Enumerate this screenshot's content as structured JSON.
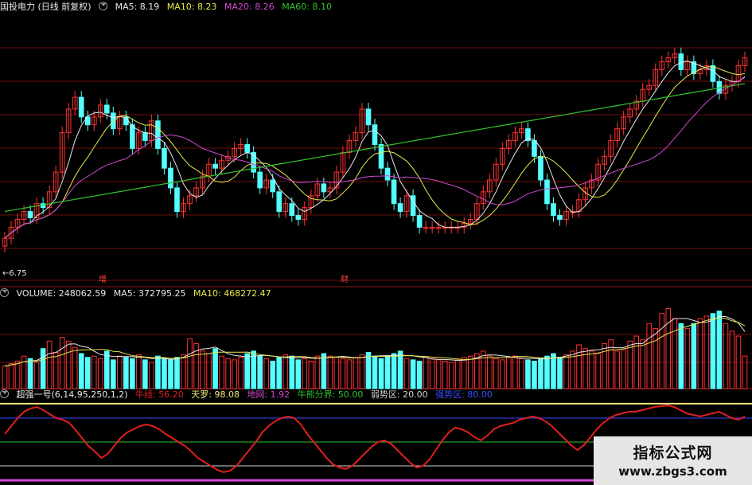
{
  "main_header": {
    "title": "国投电力 (日线 前复权)",
    "ma5": "MA5: 8.19",
    "ma10": "MA10: 8.23",
    "ma20": "MA20: 8.26",
    "ma60": "MA60: 8.10"
  },
  "price_low_label": "←6.75",
  "event_tags": [
    "增",
    "财"
  ],
  "volume_header": {
    "volume": "VOLUME: 248062.59",
    "ma5": "MA5: 372795.25",
    "ma10": "MA10: 468272.47"
  },
  "indicator_header": {
    "name": "超强一号(6,14,95,250,1,2)",
    "c1": "牛线: 56.20",
    "c2": "天罗: 98.08",
    "c3": "地网: 1.92",
    "c4": "牛熊分界: 50.00",
    "c5": "弱势区: 20.00",
    "c6": "强势区: 80.00"
  },
  "watermark": {
    "line1": "指标公式网",
    "line2": "www.zbgs3.com"
  },
  "colors": {
    "up": "#ff3232",
    "down": "#54ffff",
    "ma5": "#e8e8e8",
    "ma10": "#e8e84a",
    "ma20": "#d24ad2",
    "ma60": "#2ec42e",
    "grid": "#6e0e0e",
    "osc": "#e02020",
    "band": "#f2e87a"
  },
  "chart_data": {
    "type": "candlestick",
    "price_range": [
      6.75,
      9.6
    ],
    "close": [
      6.96,
      7.1,
      7.2,
      7.3,
      7.22,
      7.4,
      7.35,
      7.55,
      7.8,
      8.3,
      8.6,
      8.75,
      8.5,
      8.4,
      8.5,
      8.65,
      8.55,
      8.35,
      8.5,
      8.4,
      8.1,
      8.3,
      8.2,
      8.45,
      8.1,
      7.85,
      7.6,
      7.3,
      7.4,
      7.5,
      7.6,
      7.75,
      7.9,
      7.85,
      7.95,
      8.0,
      8.1,
      8.15,
      8.05,
      7.8,
      7.6,
      7.7,
      7.55,
      7.3,
      7.4,
      7.25,
      7.2,
      7.35,
      7.5,
      7.65,
      7.55,
      7.6,
      7.8,
      8.05,
      8.2,
      8.3,
      8.6,
      8.4,
      8.15,
      7.85,
      7.7,
      7.4,
      7.3,
      7.5,
      7.25,
      7.1,
      7.1,
      7.1,
      7.1,
      7.1,
      7.1,
      7.1,
      7.15,
      7.2,
      7.4,
      7.55,
      7.7,
      7.9,
      8.1,
      8.2,
      8.3,
      8.35,
      8.2,
      8.0,
      7.7,
      7.4,
      7.25,
      7.2,
      7.3,
      7.3,
      7.45,
      7.6,
      7.7,
      7.9,
      8.0,
      8.2,
      8.35,
      8.5,
      8.6,
      8.7,
      8.85,
      8.9,
      9.1,
      9.2,
      9.25,
      9.3,
      9.1,
      9.2,
      9.05,
      9.1,
      9.15,
      8.95,
      8.8,
      8.9,
      8.95,
      9.15,
      9.25
    ],
    "volume_range": [
      0,
      700000
    ],
    "volume": [
      180000,
      200000,
      220000,
      260000,
      240000,
      210000,
      320000,
      380000,
      290000,
      410000,
      380000,
      330000,
      280000,
      250000,
      260000,
      240000,
      300000,
      230000,
      260000,
      250000,
      240000,
      270000,
      230000,
      210000,
      260000,
      240000,
      230000,
      250000,
      270000,
      400000,
      360000,
      300000,
      280000,
      320000,
      260000,
      240000,
      230000,
      250000,
      280000,
      300000,
      260000,
      240000,
      220000,
      250000,
      270000,
      260000,
      230000,
      240000,
      220000,
      260000,
      280000,
      260000,
      250000,
      240000,
      230000,
      250000,
      270000,
      290000,
      260000,
      240000,
      260000,
      280000,
      300000,
      240000,
      230000,
      220000,
      250000,
      240000,
      230000,
      220000,
      210000,
      230000,
      250000,
      260000,
      280000,
      300000,
      260000,
      240000,
      230000,
      250000,
      260000,
      240000,
      230000,
      220000,
      240000,
      260000,
      280000,
      250000,
      270000,
      300000,
      350000,
      320000,
      300000,
      280000,
      360000,
      390000,
      300000,
      310000,
      380000,
      420000,
      390000,
      520000,
      480000,
      600000,
      640000,
      560000,
      520000,
      480000,
      520000,
      560000,
      580000,
      600000,
      620000,
      520000,
      460000,
      420000,
      260000
    ],
    "oscillator_range": [
      0,
      100
    ],
    "oscillator": [
      60,
      70,
      80,
      88,
      92,
      94,
      90,
      85,
      80,
      78,
      74,
      65,
      55,
      45,
      38,
      30,
      35,
      45,
      55,
      62,
      66,
      70,
      72,
      70,
      66,
      60,
      55,
      50,
      45,
      38,
      30,
      25,
      20,
      15,
      12,
      14,
      20,
      30,
      40,
      50,
      62,
      70,
      76,
      80,
      82,
      80,
      72,
      60,
      50,
      40,
      30,
      22,
      18,
      16,
      20,
      28,
      36,
      44,
      50,
      52,
      48,
      40,
      32,
      24,
      18,
      20,
      28,
      40,
      52,
      62,
      68,
      66,
      62,
      56,
      52,
      58,
      66,
      70,
      72,
      74,
      78,
      80,
      82,
      80,
      76,
      70,
      62,
      54,
      46,
      40,
      46,
      56,
      66,
      74,
      80,
      84,
      86,
      88,
      88,
      90,
      92,
      94,
      95,
      96,
      94,
      90,
      86,
      84,
      82,
      84,
      86,
      88,
      84,
      80,
      78,
      82
    ],
    "oscillator_levels": {
      "tianluo": 98.08,
      "diwang": 1.92,
      "bull_bear": 50,
      "weak": 20,
      "strong": 80
    }
  }
}
